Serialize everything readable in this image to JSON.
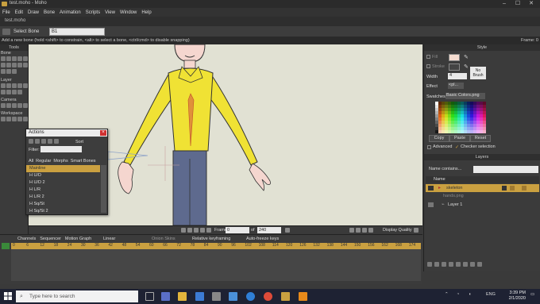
{
  "window": {
    "title": "test.moho - Moho"
  },
  "menu": [
    "File",
    "Edit",
    "Draw",
    "Bone",
    "Animation",
    "Scripts",
    "View",
    "Window",
    "Help"
  ],
  "doc_tab": "test.moho",
  "toolbar": {
    "tool_name": "Select Bone",
    "field_value": "B1"
  },
  "status": {
    "hint": "Add a new bone (hold <shift> to constrain, <alt> to select a bone, <ctrl/cmd> to disable snapping)",
    "frame": "Frame: 0"
  },
  "tools_panel": {
    "title": "Tools",
    "groups": [
      "Bone",
      "Layer",
      "Camera",
      "Workspace"
    ]
  },
  "canvas_bar": {
    "frame_label": "Frame",
    "frame_value": "0",
    "of_label": "of",
    "total_frames": "240",
    "display_quality": "Display Quality"
  },
  "style_panel": {
    "title": "Style",
    "fill_label": "Fill",
    "stroke_label": "Stroke",
    "width_label": "Width",
    "width_value": "4",
    "effect_label": "Effect",
    "effect_value": "<pl...",
    "no_brush": "No Brush",
    "swatches_label": "Swatches",
    "swatches_value": "Basic Colors.png",
    "copy": "Copy",
    "paste": "Paste",
    "reset": "Reset",
    "advanced": "Advanced",
    "checker": "Checker selection"
  },
  "layers_panel": {
    "title": "Layers",
    "filter_label": "Name contains...",
    "name_col": "Name",
    "items": [
      "skeleton",
      "hands.png",
      "Layer 1"
    ]
  },
  "actions_dialog": {
    "title": "Actions",
    "sort": "Sort",
    "filter_label": "Filter:",
    "tabs": [
      "All",
      "Regular",
      "Morphs",
      "Smart Bones"
    ],
    "items": [
      "Mainline",
      "H U/D",
      "H U/D 2",
      "H L/R",
      "H L/R 2",
      "H Sq/St",
      "H Sq/St 2"
    ]
  },
  "timeline": {
    "tabs": [
      "Channels",
      "Sequencer",
      "Motion Graph"
    ],
    "interp": "Linear",
    "onion": "Onion Skins",
    "relative": "Relative keyframing",
    "autofreeze": "Auto-freeze keys",
    "ticks": [
      "0",
      "6",
      "12",
      "18",
      "24",
      "30",
      "36",
      "42",
      "48",
      "54",
      "60",
      "66",
      "72",
      "78",
      "84",
      "90",
      "96",
      "102",
      "108",
      "114",
      "120",
      "126",
      "132",
      "138",
      "144",
      "150",
      "156",
      "162",
      "168",
      "174"
    ]
  },
  "taskbar": {
    "search_placeholder": "Type here to search",
    "lang": "ENG",
    "time": "3:39 PM",
    "date": "2/1/2020"
  },
  "colors": {
    "accent": "#caa040",
    "canvas_bg": "#e1e1d3",
    "shirt": "#f0e234",
    "pants": "#5e6a8e",
    "skin": "#f5d6cf",
    "tie": "#e0903a",
    "fill_swatch": "#f5dcd0"
  }
}
